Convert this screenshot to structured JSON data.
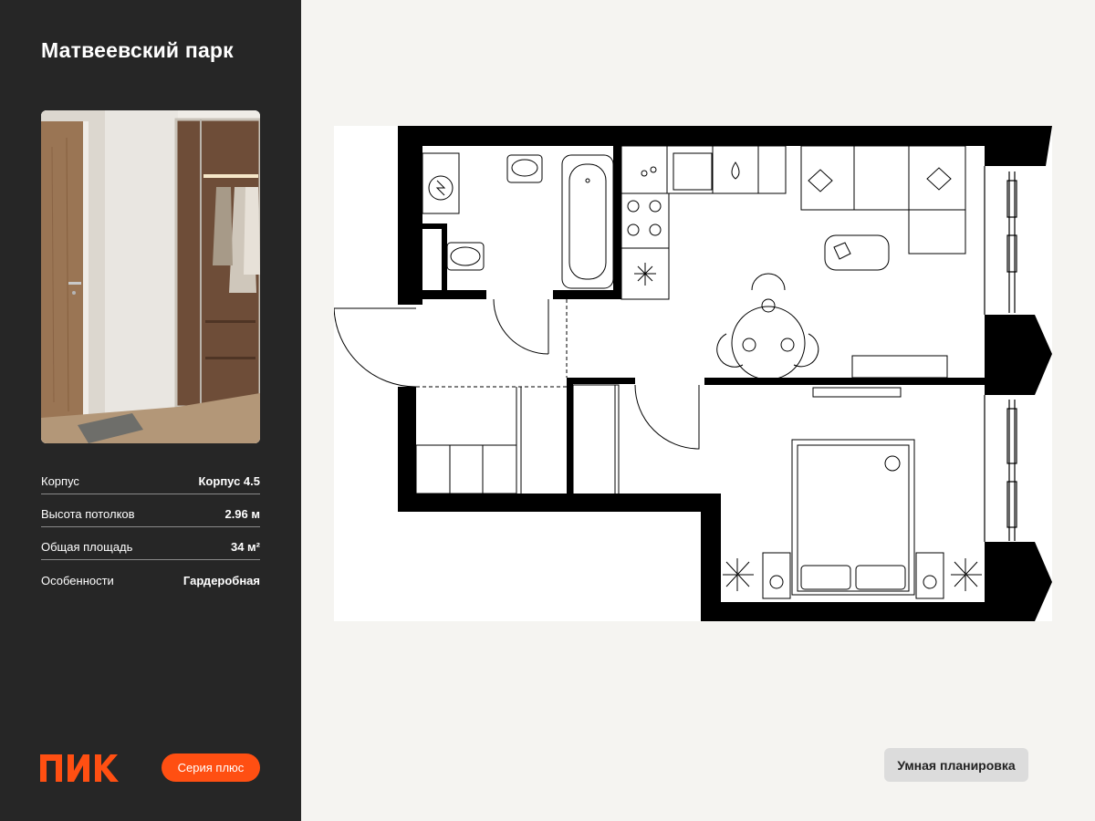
{
  "project": {
    "title": "Матвеевский парк"
  },
  "specs": [
    {
      "label": "Корпус",
      "value": "Корпус 4.5"
    },
    {
      "label": "Высота потолков",
      "value": "2.96 м"
    },
    {
      "label": "Общая площадь",
      "value": "34 м²"
    },
    {
      "label": "Особенности",
      "value": "Гардеробная"
    }
  ],
  "brand": {
    "logo": "ПИК",
    "series": "Серия плюс",
    "accent_color": "#ff4f12"
  },
  "badge": {
    "smart_layout": "Умная планировка"
  }
}
